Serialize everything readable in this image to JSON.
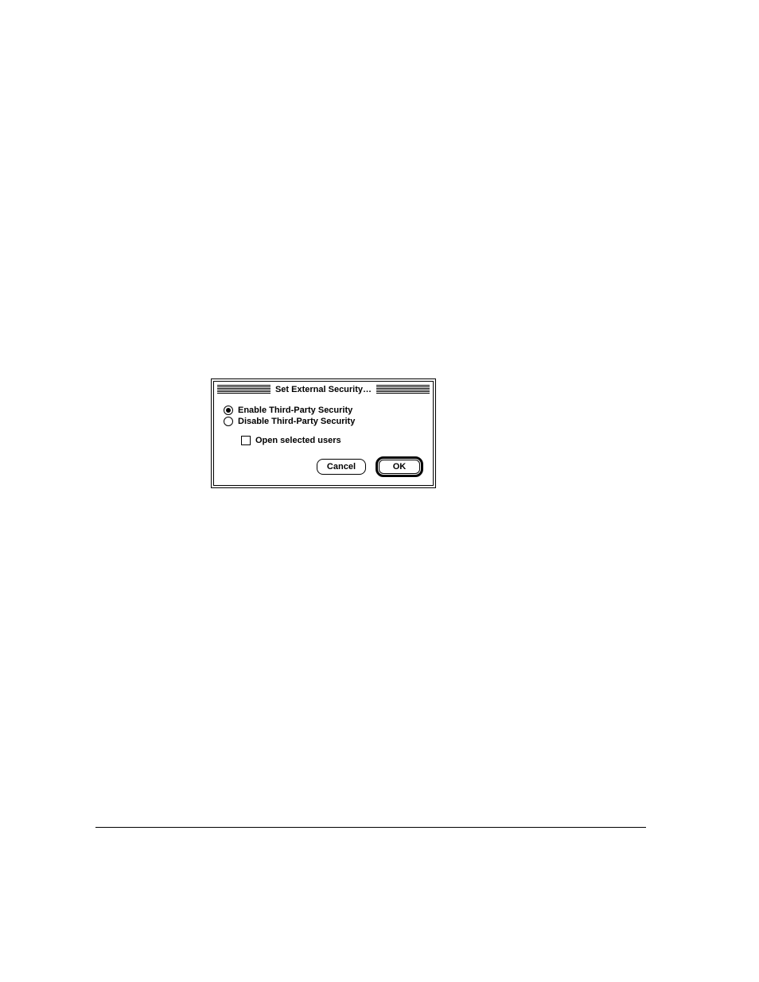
{
  "dialog": {
    "title": "Set External Security…",
    "radios": {
      "enable": {
        "label": "Enable Third-Party Security",
        "checked": true
      },
      "disable": {
        "label": "Disable Third-Party Security",
        "checked": false
      }
    },
    "checkbox": {
      "open_users": {
        "label": "Open selected users",
        "checked": false
      }
    },
    "buttons": {
      "cancel": "Cancel",
      "ok": "OK"
    }
  }
}
